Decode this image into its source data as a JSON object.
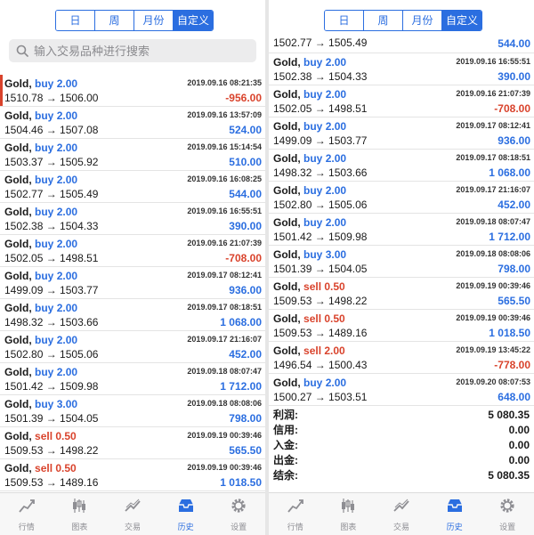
{
  "segments": [
    "日",
    "周",
    "月份",
    "自定义"
  ],
  "active_segment": 3,
  "search": {
    "placeholder": "输入交易品种进行搜索"
  },
  "left_rows": [
    {
      "symbol": "Gold,",
      "side": "buy",
      "lots": "2.00",
      "time": "2019.09.16 08:21:35",
      "prices": "1510.78 → 1506.00",
      "profit": "-956.00",
      "neg": true,
      "selected": true
    },
    {
      "symbol": "Gold,",
      "side": "buy",
      "lots": "2.00",
      "time": "2019.09.16 13:57:09",
      "prices": "1504.46 → 1507.08",
      "profit": "524.00",
      "neg": false
    },
    {
      "symbol": "Gold,",
      "side": "buy",
      "lots": "2.00",
      "time": "2019.09.16 15:14:54",
      "prices": "1503.37 → 1505.92",
      "profit": "510.00",
      "neg": false
    },
    {
      "symbol": "Gold,",
      "side": "buy",
      "lots": "2.00",
      "time": "2019.09.16 16:08:25",
      "prices": "1502.77 → 1505.49",
      "profit": "544.00",
      "neg": false
    },
    {
      "symbol": "Gold,",
      "side": "buy",
      "lots": "2.00",
      "time": "2019.09.16 16:55:51",
      "prices": "1502.38 → 1504.33",
      "profit": "390.00",
      "neg": false
    },
    {
      "symbol": "Gold,",
      "side": "buy",
      "lots": "2.00",
      "time": "2019.09.16 21:07:39",
      "prices": "1502.05 → 1498.51",
      "profit": "-708.00",
      "neg": true
    },
    {
      "symbol": "Gold,",
      "side": "buy",
      "lots": "2.00",
      "time": "2019.09.17 08:12:41",
      "prices": "1499.09 → 1503.77",
      "profit": "936.00",
      "neg": false
    },
    {
      "symbol": "Gold,",
      "side": "buy",
      "lots": "2.00",
      "time": "2019.09.17 08:18:51",
      "prices": "1498.32 → 1503.66",
      "profit": "1 068.00",
      "neg": false
    },
    {
      "symbol": "Gold,",
      "side": "buy",
      "lots": "2.00",
      "time": "2019.09.17 21:16:07",
      "prices": "1502.80 → 1505.06",
      "profit": "452.00",
      "neg": false
    },
    {
      "symbol": "Gold,",
      "side": "buy",
      "lots": "2.00",
      "time": "2019.09.18 08:07:47",
      "prices": "1501.42 → 1509.98",
      "profit": "1 712.00",
      "neg": false
    },
    {
      "symbol": "Gold,",
      "side": "buy",
      "lots": "3.00",
      "time": "2019.09.18 08:08:06",
      "prices": "1501.39 → 1504.05",
      "profit": "798.00",
      "neg": false
    },
    {
      "symbol": "Gold,",
      "side": "sell",
      "lots": "0.50",
      "time": "2019.09.19 00:39:46",
      "prices": "1509.53 → 1498.22",
      "profit": "565.50",
      "neg": false
    },
    {
      "symbol": "Gold,",
      "side": "sell",
      "lots": "0.50",
      "time": "2019.09.19 00:39:46",
      "prices": "1509.53 → 1489.16",
      "profit": "1 018.50",
      "neg": false
    }
  ],
  "right_top": {
    "prices": "1502.77 → 1505.49",
    "profit": "544.00"
  },
  "right_rows": [
    {
      "symbol": "Gold,",
      "side": "buy",
      "lots": "2.00",
      "time": "2019.09.16 16:55:51",
      "prices": "1502.38 → 1504.33",
      "profit": "390.00",
      "neg": false
    },
    {
      "symbol": "Gold,",
      "side": "buy",
      "lots": "2.00",
      "time": "2019.09.16 21:07:39",
      "prices": "1502.05 → 1498.51",
      "profit": "-708.00",
      "neg": true
    },
    {
      "symbol": "Gold,",
      "side": "buy",
      "lots": "2.00",
      "time": "2019.09.17 08:12:41",
      "prices": "1499.09 → 1503.77",
      "profit": "936.00",
      "neg": false
    },
    {
      "symbol": "Gold,",
      "side": "buy",
      "lots": "2.00",
      "time": "2019.09.17 08:18:51",
      "prices": "1498.32 → 1503.66",
      "profit": "1 068.00",
      "neg": false
    },
    {
      "symbol": "Gold,",
      "side": "buy",
      "lots": "2.00",
      "time": "2019.09.17 21:16:07",
      "prices": "1502.80 → 1505.06",
      "profit": "452.00",
      "neg": false
    },
    {
      "symbol": "Gold,",
      "side": "buy",
      "lots": "2.00",
      "time": "2019.09.18 08:07:47",
      "prices": "1501.42 → 1509.98",
      "profit": "1 712.00",
      "neg": false
    },
    {
      "symbol": "Gold,",
      "side": "buy",
      "lots": "3.00",
      "time": "2019.09.18 08:08:06",
      "prices": "1501.39 → 1504.05",
      "profit": "798.00",
      "neg": false
    },
    {
      "symbol": "Gold,",
      "side": "sell",
      "lots": "0.50",
      "time": "2019.09.19 00:39:46",
      "prices": "1509.53 → 1498.22",
      "profit": "565.50",
      "neg": false
    },
    {
      "symbol": "Gold,",
      "side": "sell",
      "lots": "0.50",
      "time": "2019.09.19 00:39:46",
      "prices": "1509.53 → 1489.16",
      "profit": "1 018.50",
      "neg": false
    },
    {
      "symbol": "Gold,",
      "side": "sell",
      "lots": "2.00",
      "time": "2019.09.19 13:45:22",
      "prices": "1496.54 → 1500.43",
      "profit": "-778.00",
      "neg": true
    },
    {
      "symbol": "Gold,",
      "side": "buy",
      "lots": "2.00",
      "time": "2019.09.20 08:07:53",
      "prices": "1500.27 → 1503.51",
      "profit": "648.00",
      "neg": false
    }
  ],
  "summary": [
    {
      "label": "利润:",
      "value": "5 080.35"
    },
    {
      "label": "信用:",
      "value": "0.00"
    },
    {
      "label": "入金:",
      "value": "0.00"
    },
    {
      "label": "出金:",
      "value": "0.00"
    },
    {
      "label": "结余:",
      "value": "5 080.35"
    }
  ],
  "tabs": [
    {
      "label": "行情",
      "icon": "quotes-icon"
    },
    {
      "label": "图表",
      "icon": "chart-icon"
    },
    {
      "label": "交易",
      "icon": "trade-icon"
    },
    {
      "label": "历史",
      "icon": "history-icon"
    },
    {
      "label": "设置",
      "icon": "settings-icon"
    }
  ],
  "active_tab": 3
}
